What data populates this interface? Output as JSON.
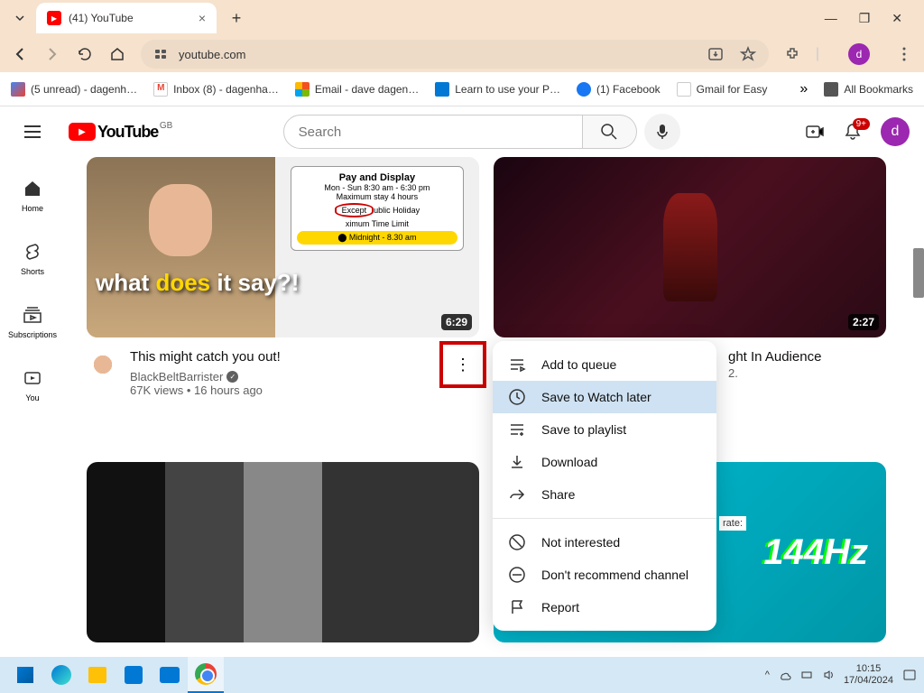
{
  "browser": {
    "tab_title": "(41) YouTube",
    "url": "youtube.com",
    "profile_letter": "d"
  },
  "bookmarks": {
    "items": [
      "(5 unread) - dagenh…",
      "Inbox (8) - dagenha…",
      "Email - dave dagen…",
      "Learn to use your P…",
      "(1) Facebook",
      "Gmail for Easy"
    ],
    "all": "All Bookmarks"
  },
  "yt": {
    "search_placeholder": "Search",
    "country": "GB",
    "notif_count": "9+",
    "avatar_letter": "d"
  },
  "sidebar": {
    "home": "Home",
    "shorts": "Shorts",
    "subs": "Subscriptions",
    "you": "You"
  },
  "videos": {
    "v1": {
      "thumb_text_1": "what ",
      "thumb_text_2": "does ",
      "thumb_text_3": "it say?!",
      "sign_title": "Pay and Display",
      "sign_line1": "Mon - Sun 8:30 am - 6:30 pm",
      "sign_line2": "Maximum stay 4 hours",
      "sign_except": "Except",
      "sign_holiday": "ublic Holiday",
      "sign_limit": "ximum Time Limit",
      "sign_midnight": "⬤ Midnight - 8.30 am",
      "duration": "6:29",
      "title": "This might catch you out!",
      "channel": "BlackBeltBarrister",
      "stats": "67K views • 16 hours ago"
    },
    "v2": {
      "duration": "2:27",
      "title_partial": "ght In Audience",
      "subtitle_partial": "2."
    },
    "v4": {
      "hz": "144Hz",
      "rate": "rate:"
    }
  },
  "context_menu": {
    "add_queue": "Add to queue",
    "watch_later": "Save to Watch later",
    "playlist": "Save to playlist",
    "download": "Download",
    "share": "Share",
    "not_interested": "Not interested",
    "dont_recommend": "Don't recommend channel",
    "report": "Report"
  },
  "taskbar": {
    "time": "10:15",
    "date": "17/04/2024"
  }
}
